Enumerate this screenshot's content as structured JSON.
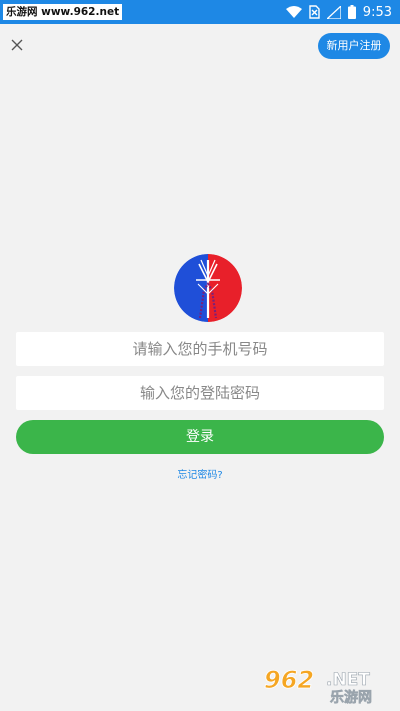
{
  "status_bar": {
    "source_label": "乐游网 www.962.net",
    "time": "9:53",
    "icons": [
      "wifi-icon",
      "no-sim-icon",
      "signal-icon",
      "battery-icon"
    ],
    "color": "#1e88e5"
  },
  "header": {
    "close_icon": "close-icon",
    "register_label": "新用户注册"
  },
  "logo": {
    "icon": "app-logo",
    "colors": [
      "#1f4fd8",
      "#e8202a"
    ]
  },
  "form": {
    "phone_placeholder": "请输入您的手机号码",
    "password_placeholder": "输入您的登陆密码",
    "login_label": "登录",
    "forgot_label": "忘记密码?"
  },
  "watermark": {
    "brand": "962",
    "suffix": ".NET",
    "site_name": "乐游网"
  },
  "colors": {
    "accent": "#1e88e5",
    "login": "#3bb54a",
    "background": "#f2f2f2"
  }
}
